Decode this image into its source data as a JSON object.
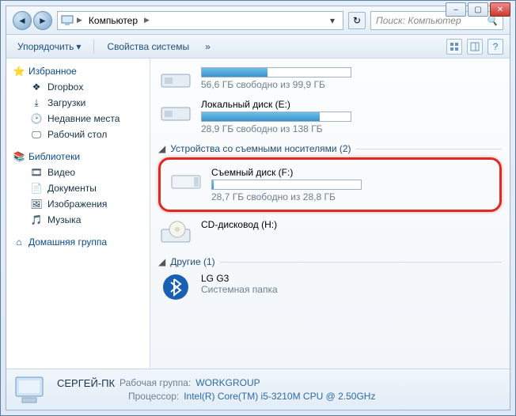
{
  "titlebar": {
    "min": "–",
    "max": "▢",
    "close": "✕"
  },
  "nav": {
    "back": "◄",
    "fwd": "►",
    "breadcrumb_root": "Компьютер",
    "dropdown": "▾",
    "refresh": "↻",
    "search_placeholder": "Поиск: Компьютер",
    "search_icon": "🔍"
  },
  "toolbar": {
    "organize": "Упорядочить",
    "organize_arrow": "▾",
    "props": "Свойства системы",
    "chev": "»",
    "help": "?"
  },
  "sidebar": {
    "favorites": {
      "label": "Избранное",
      "items": [
        {
          "icon": "dropbox-icon",
          "glyph": "❖",
          "label": "Dropbox"
        },
        {
          "icon": "downloads-icon",
          "glyph": "⤓",
          "label": "Загрузки"
        },
        {
          "icon": "recent-icon",
          "glyph": "🕑",
          "label": "Недавние места"
        },
        {
          "icon": "desktop-icon",
          "glyph": "🖵",
          "label": "Рабочий стол"
        }
      ]
    },
    "libraries": {
      "label": "Библиотеки",
      "items": [
        {
          "icon": "video-icon",
          "glyph": "🎞",
          "label": "Видео"
        },
        {
          "icon": "docs-icon",
          "glyph": "📄",
          "label": "Документы"
        },
        {
          "icon": "images-icon",
          "glyph": "🖼",
          "label": "Изображения"
        },
        {
          "icon": "music-icon",
          "glyph": "🎵",
          "label": "Музыка"
        }
      ]
    },
    "homegroup": {
      "icon": "homegroup-icon",
      "glyph": "⌂",
      "label": "Домашняя группа"
    }
  },
  "content": {
    "partial_drive": {
      "free_text": "56,6 ГБ свободно из 99,9 ГБ"
    },
    "drive_e": {
      "label": "Локальный диск (E:)",
      "free_text": "28,9 ГБ свободно из 138 ГБ",
      "fill_pct": 79
    },
    "removable_section": {
      "label": "Устройства со съемными носителями (2)",
      "arrow": "◢"
    },
    "drive_f": {
      "label": "Съемный диск (F:)",
      "free_text": "28,7 ГБ свободно из 28,8 ГБ",
      "fill_pct": 1
    },
    "cd_h": {
      "label": "CD-дисковод (H:)"
    },
    "other_section": {
      "label": "Другие (1)",
      "arrow": "◢"
    },
    "bt": {
      "label": "LG G3",
      "sub": "Системная папка"
    }
  },
  "status": {
    "pc_name": "СЕРГЕЙ-ПК",
    "workgroup_label": "Рабочая группа:",
    "workgroup": "WORKGROUP",
    "cpu_label": "Процессор:",
    "cpu": "Intel(R) Core(TM) i5-3210M CPU @ 2.50GHz"
  }
}
